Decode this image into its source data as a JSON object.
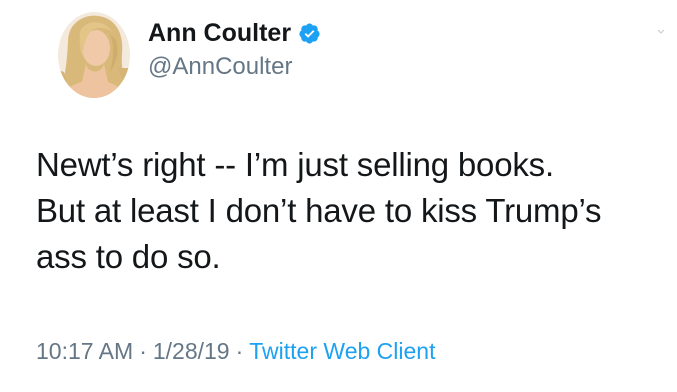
{
  "tweet": {
    "author": {
      "display_name": "Ann Coulter",
      "handle": "@AnnCoulter",
      "verified_icon": "verified-badge-icon",
      "avatar_icon": "profile-photo"
    },
    "text": "Newt’s right -- I’m just selling books.\nBut at least I don’t have to kiss Trump’s\nass to do so.",
    "time": "10:17 AM",
    "separator": "·",
    "date": "1/28/19",
    "source": "Twitter Web Client"
  },
  "colors": {
    "text": "#14171a",
    "secondary": "#657786",
    "link": "#1da1f2",
    "verified": "#1da1f2"
  }
}
